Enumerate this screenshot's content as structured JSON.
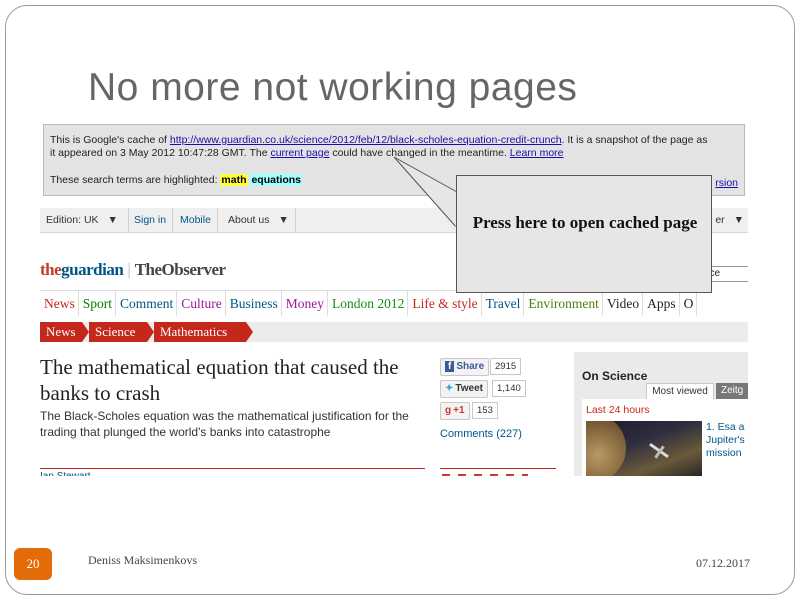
{
  "slide": {
    "title": "No more not working pages",
    "number": "20",
    "author": "Deniss Maksimenkovs",
    "date": "07.12.2017"
  },
  "cache_banner": {
    "line1_prefix": "This is Google's cache of ",
    "url": "http://www.guardian.co.uk/science/2012/feb/12/black-scholes-equation-credit-crunch",
    "line1_suffix": ". It is a snapshot of the page as",
    "line2_prefix": "it appeared on 3 May 2012 10:47:28 GMT. The ",
    "current_page": "current page",
    "line2_mid": " could have changed in the meantime. ",
    "learn_more": "Learn more",
    "terms_prefix": "These search terms are highlighted: ",
    "term1": "math",
    "term2": "equations",
    "version_link": "rsion"
  },
  "topbar": {
    "edition": "Edition: UK",
    "sign_in": "Sign in",
    "mobile": "Mobile",
    "about": "About us",
    "right_fragment": "er"
  },
  "logo": {
    "the": "the",
    "guardian": "guardian",
    "observer": "TheObserver"
  },
  "search_value": "nce",
  "sections": [
    {
      "label": "News",
      "color": "#c4281b"
    },
    {
      "label": "Sport",
      "color": "#008000"
    },
    {
      "label": "Comment",
      "color": "#005689"
    },
    {
      "label": "Culture",
      "color": "#a0169e"
    },
    {
      "label": "Business",
      "color": "#005689"
    },
    {
      "label": "Money",
      "color": "#a0169e"
    },
    {
      "label": "London 2012",
      "color": "#138a13"
    },
    {
      "label": "Life & style",
      "color": "#c4281b"
    },
    {
      "label": "Travel",
      "color": "#005689"
    },
    {
      "label": "Environment",
      "color": "#4f7f0a"
    },
    {
      "label": "Video",
      "color": "#222222"
    },
    {
      "label": "Apps",
      "color": "#222222"
    },
    {
      "label": "O",
      "color": "#222222"
    }
  ],
  "breadcrumbs": [
    "News",
    "Science",
    "Mathematics"
  ],
  "article": {
    "headline": "The mathematical equation that caused the banks to crash",
    "standfirst": "The Black-Scholes equation was the mathematical justification for the trading that plunged the world's banks into catastrophe",
    "byline_fragment": "Ian Stewart"
  },
  "share": {
    "facebook_label": "Share",
    "facebook_count": "2915",
    "twitter_label": "Tweet",
    "twitter_count": "1,140",
    "gplus_label": "+1",
    "gplus_count": "153",
    "comments": "Comments (227)"
  },
  "sidebar": {
    "title": "On Science",
    "tab_most_viewed": "Most viewed",
    "tab_other": "Zeitg",
    "subheading": "Last 24 hours",
    "story": "1. Esa a Jupiter's mission"
  },
  "callout": {
    "text": "Press here to open cached page"
  },
  "colors": {
    "guardian_blue": "#005689",
    "guardian_red": "#c4281b",
    "slide_number_orange": "#e36c09",
    "highlight_yellow": "#ffff3f",
    "highlight_cyan": "#a0ffff"
  }
}
